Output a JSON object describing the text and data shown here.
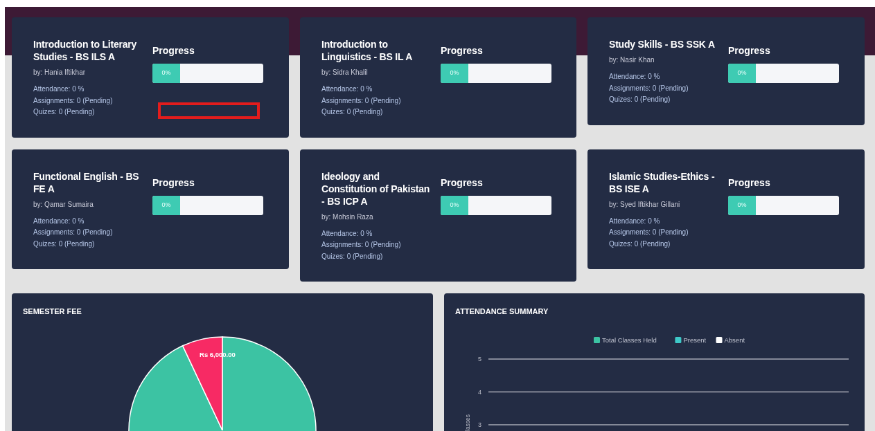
{
  "courses": [
    {
      "title": "Introduction to Literary Studies - BS ILS A",
      "teacher": "by: Hania Iftikhar",
      "attendance": "Attendance: 0 %",
      "assignments": "Assignments: 0 (Pending)",
      "quizzes": "Quizes: 0 (Pending)",
      "progress_label": "Progress",
      "progress_text": "0%",
      "level": 0,
      "highlighted": true
    },
    {
      "title": "Introduction to Linguistics - BS IL A",
      "teacher": "by: Sidra Khalil",
      "attendance": "Attendance: 0 %",
      "assignments": "Assignments: 0 (Pending)",
      "quizzes": "Quizes: 0 (Pending)",
      "progress_label": "Progress",
      "progress_text": "0%",
      "level": 0,
      "highlighted": false
    },
    {
      "title": "Study Skills - BS SSK A",
      "teacher": "by: Nasir Khan",
      "attendance": "Attendance: 0 %",
      "assignments": "Assignments: 0 (Pending)",
      "quizzes": "Quizes: 0 (Pending)",
      "progress_label": "Progress",
      "progress_text": "0%",
      "level": 0,
      "highlighted": false
    },
    {
      "title": "Functional English - BS FE A",
      "teacher": "by: Qamar Sumaira",
      "attendance": "Attendance: 0 %",
      "assignments": "Assignments: 0 (Pending)",
      "quizzes": "Quizes: 0 (Pending)",
      "progress_label": "Progress",
      "progress_text": "0%",
      "level": 0,
      "highlighted": false
    },
    {
      "title": "Ideology and Constitution of Pakistan - BS ICP A",
      "teacher": "by: Mohsin Raza",
      "attendance": "Attendance: 0 %",
      "assignments": "Assignments: 0 (Pending)",
      "quizzes": "Quizes: 0 (Pending)",
      "progress_label": "Progress",
      "progress_text": "0%",
      "level": 0,
      "highlighted": false
    },
    {
      "title": "Islamic Studies-Ethics - BS ISE A",
      "teacher": "by: Syed Iftikhar Gillani",
      "attendance": "Attendance: 0 %",
      "assignments": "Assignments: 0 (Pending)",
      "quizzes": "Quizes: 0 (Pending)",
      "progress_label": "Progress",
      "progress_text": "0%",
      "level": 0,
      "highlighted": false
    }
  ],
  "semester_fee": {
    "title": "SEMESTER FEE",
    "chart_data": {
      "type": "pie",
      "values": [
        80000,
        6000
      ],
      "colors": [
        "#3cc3a3",
        "#f72a64"
      ],
      "value_labels": [
        null,
        "Rs 6,000.00"
      ]
    }
  },
  "attendance_summary": {
    "title": "ATTENDANCE SUMMARY",
    "chart_data": {
      "type": "bar",
      "ylabel": "lasses",
      "ylim": [
        0,
        5
      ],
      "yticks": [
        3,
        4,
        5
      ],
      "series": [
        {
          "name": "Total Classes Held",
          "color": "#3cc3a3",
          "values": [
            null
          ]
        },
        {
          "name": "Present",
          "color": "#3ec8c8",
          "values": [
            null
          ]
        },
        {
          "name": "Absent",
          "color": "#ffffff",
          "values": [
            null
          ]
        }
      ]
    }
  }
}
